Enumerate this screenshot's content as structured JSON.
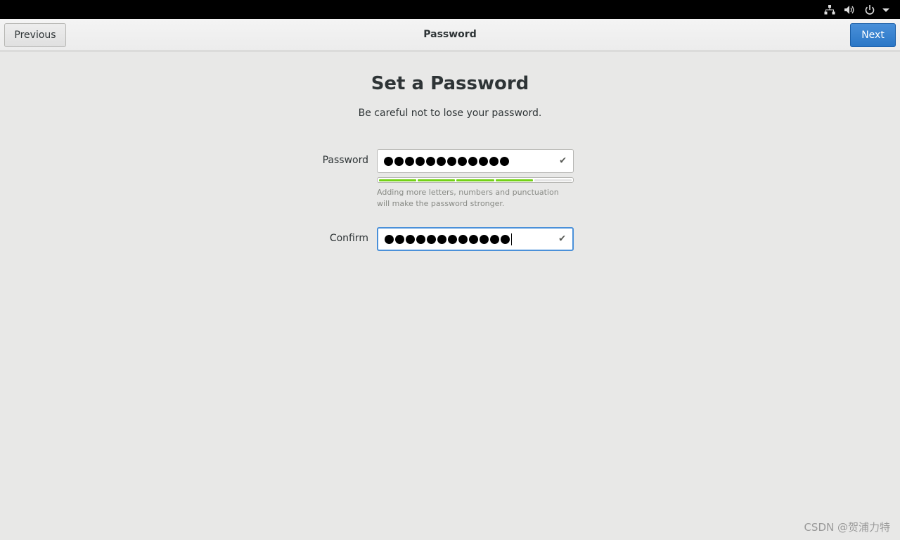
{
  "system_tray": {
    "icons": [
      "network-icon",
      "volume-icon",
      "power-icon",
      "menu-arrow-icon"
    ]
  },
  "header": {
    "title": "Password",
    "previous_label": "Previous",
    "next_label": "Next"
  },
  "main": {
    "title": "Set a Password",
    "subtitle": "Be careful not to lose your password."
  },
  "form": {
    "password": {
      "label": "Password",
      "masked_char_count": 12,
      "valid": true
    },
    "strength": {
      "segments_total": 5,
      "segments_filled": 4,
      "hint": "Adding more letters, numbers and punctuation will make the password stronger."
    },
    "confirm": {
      "label": "Confirm",
      "masked_char_count": 12,
      "valid": true,
      "focused": true
    }
  },
  "watermark": "CSDN @贺浦力特",
  "colors": {
    "accent": "#4a90d9",
    "strength_fill": "#73d216",
    "background": "#e8e8e7"
  }
}
